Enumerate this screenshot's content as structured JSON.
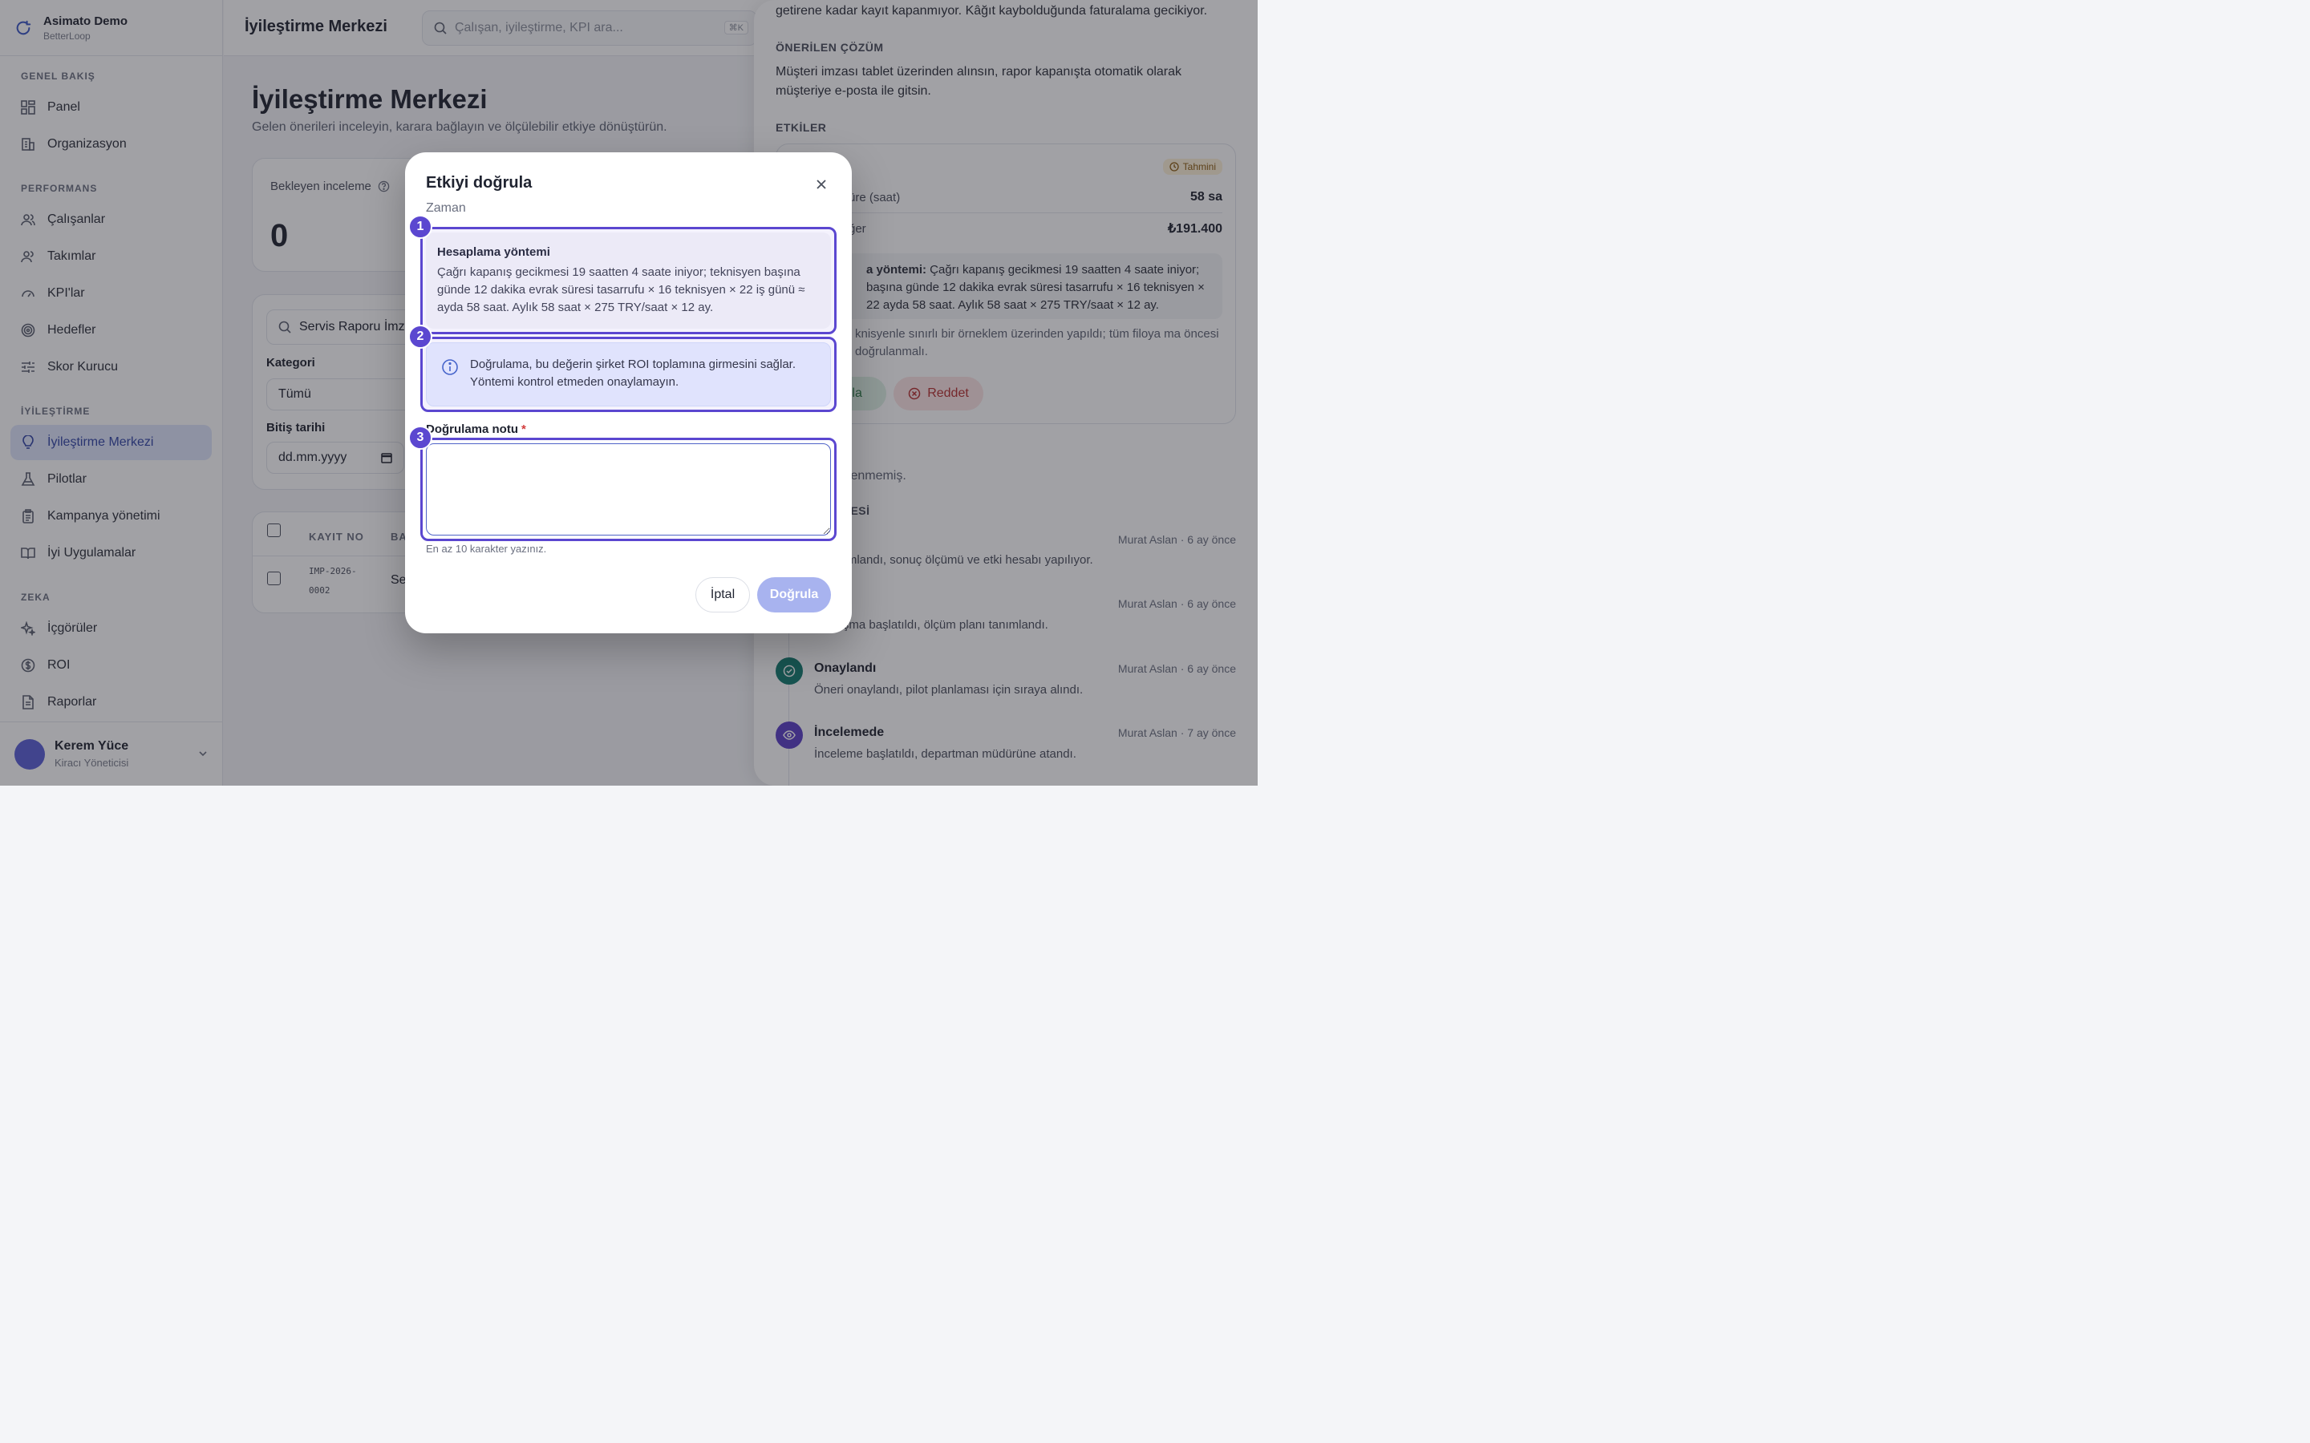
{
  "brand": {
    "name": "Asimato Demo",
    "sub": "BetterLoop"
  },
  "sidebar": {
    "sections": [
      {
        "title": "GENEL BAKIŞ",
        "items": [
          {
            "label": "Panel"
          },
          {
            "label": "Organizasyon"
          }
        ]
      },
      {
        "title": "PERFORMANS",
        "items": [
          {
            "label": "Çalışanlar"
          },
          {
            "label": "Takımlar"
          },
          {
            "label": "KPI'lar"
          },
          {
            "label": "Hedefler"
          },
          {
            "label": "Skor Kurucu"
          }
        ]
      },
      {
        "title": "İYİLEŞTİRME",
        "items": [
          {
            "label": "İyileştirme Merkezi"
          },
          {
            "label": "Pilotlar"
          },
          {
            "label": "Kampanya yönetimi"
          },
          {
            "label": "İyi Uygulamalar"
          }
        ]
      },
      {
        "title": "ZEKA",
        "items": [
          {
            "label": "İçgörüler"
          },
          {
            "label": "ROI"
          },
          {
            "label": "Raporlar"
          }
        ]
      }
    ],
    "active": "İyileştirme Merkezi"
  },
  "user": {
    "name": "Kerem Yüce",
    "role": "Kiracı Yöneticisi"
  },
  "topbar": {
    "title": "İyileştirme Merkezi",
    "search_placeholder": "Çalışan, iyileştirme, KPI ara...",
    "shortcut": "⌘K"
  },
  "main": {
    "title": "İyileştirme Merkezi",
    "subtitle": "Gelen önerileri inceleyin, karara bağlayın ve ölçülebilir etkiye dönüştürün.",
    "stat": {
      "label": "Bekleyen inceleme",
      "value": "0"
    },
    "filters": {
      "search_value": "Servis Raporu İmza",
      "category_label": "Kategori",
      "category_value": "Tümü",
      "end_date_label": "Bitiş tarihi",
      "end_date_placeholder": "dd.mm.yyyy"
    },
    "table": {
      "headers": [
        "KAYIT NO",
        "BA"
      ],
      "rows": [
        {
          "id": "IMP-2026-\n0002",
          "title": "Se"
        }
      ]
    }
  },
  "panel": {
    "problem_tail": "getirene kadar kayıt kapanmıyor. Kâğıt kaybolduğunda faturalama gecikiyor.",
    "solution_head": "ÖNERİLEN ÇÖZÜM",
    "solution_text": "Müşteri imzası tablet üzerinden alınsın, rapor kapanışta otomatik olarak müşteriye e-posta ile gitsin.",
    "impacts_head": "ETKİLER",
    "impact": {
      "badge": "Tahmini",
      "rows": [
        {
          "k": "üre (saat)",
          "v": "58 sa"
        },
        {
          "k": "ğer",
          "v": "₺191.400"
        }
      ],
      "method_prefix": "a yöntemi:",
      "method_text": " Çağrı kapanış gecikmesi 19 saatten 4 saate iniyor; başına günde 12 dakika evrak süresi tasarrufu × 16 teknisyen × 22 ayda 58 saat. Aylık 58 saat × 275 TRY/saat × 12 ay.",
      "note": "knisyenle sınırlı bir örneklem üzerinden yapıldı; tüm filoya ma öncesi doğrulanmalı.",
      "verify_label": "rula",
      "reject_label": "Reddet"
    },
    "attach_text": "eklenmemiş.",
    "history_head": "LGESİ",
    "timeline": [
      {
        "title": "",
        "meta": "Murat Aslan · 6 ay önce",
        "desc": "mamlandı, sonuç ölçümü ve etki hesabı yapılıyor."
      },
      {
        "title": "",
        "meta": "Murat Aslan · 6 ay önce",
        "desc": "alışma başlatıldı, ölçüm planı tanımlandı."
      },
      {
        "title": "Onaylandı",
        "meta": "Murat Aslan · 6 ay önce",
        "desc": "Öneri onaylandı, pilot planlaması için sıraya alındı."
      },
      {
        "title": "İncelemede",
        "meta": "Murat Aslan · 7 ay önce",
        "desc": "İnceleme başlatıldı, departman müdürüne atandı."
      }
    ]
  },
  "modal": {
    "title": "Etkiyi doğrula",
    "subtitle": "Zaman",
    "calc_head": "Hesaplama yöntemi",
    "calc_text": "Çağrı kapanış gecikmesi 19 saatten 4 saate iniyor; teknisyen başına günde 12 dakika evrak süresi tasarrufu × 16 teknisyen × 22 iş günü ≈ ayda 58 saat. Aylık 58 saat × 275 TRY/saat × 12 ay.",
    "info_text": "Doğrulama, bu değerin şirket ROI toplamına girmesini sağlar. Yöntemi kontrol etmeden onaylamayın.",
    "note_label": "Doğrulama notu",
    "note_required": "*",
    "note_value": "",
    "note_hint": "En az 10 karakter yazınız.",
    "cancel_label": "İptal",
    "confirm_label": "Doğrula",
    "steps": [
      "1",
      "2",
      "3"
    ]
  },
  "colors": {
    "accent": "#5b47d0",
    "primary_disabled": "#a8b3ef",
    "active_nav": "#dfe6fb"
  }
}
